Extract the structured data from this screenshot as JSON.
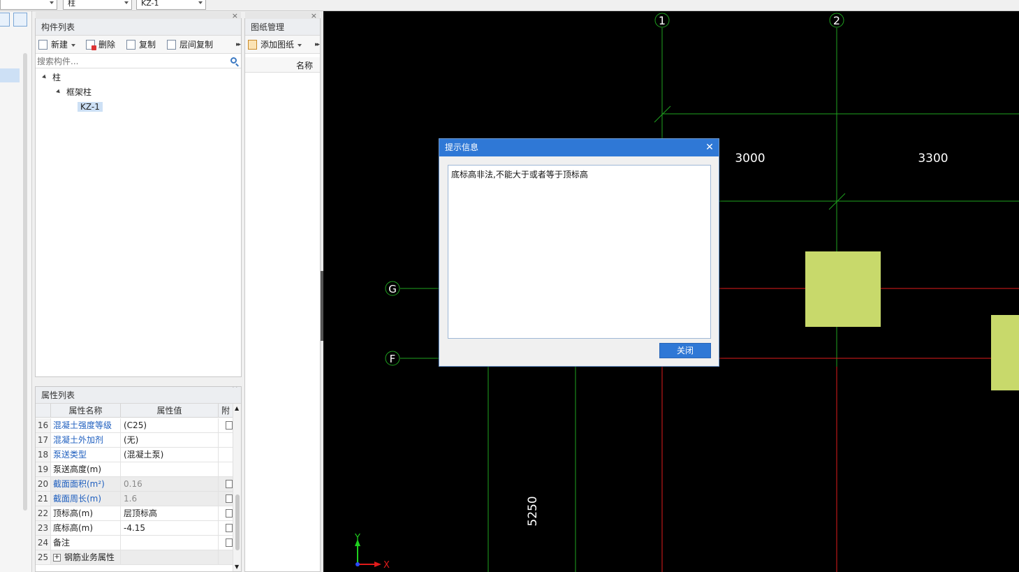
{
  "top_combos": {
    "combo1_value": "",
    "combo2_value": "柱",
    "combo3_value": "KZ-1"
  },
  "component_panel": {
    "title": "构件列表",
    "toolbar": {
      "new_label": "新建",
      "delete_label": "删除",
      "copy_label": "复制",
      "floor_copy_label": "层间复制"
    },
    "search_placeholder": "搜索构件...",
    "tree": {
      "root": "柱",
      "child": "框架柱",
      "leaf": "KZ-1"
    }
  },
  "drawing_panel": {
    "title": "图纸管理",
    "add_label": "添加图纸",
    "column_name": "名称"
  },
  "property_panel": {
    "title": "属性列表",
    "headers": [
      "属性名称",
      "属性值",
      "附"
    ],
    "rows": [
      {
        "num": "16",
        "name": "混凝土强度等级",
        "value": "(C25)",
        "checkbox": true,
        "link": true,
        "readonly": false
      },
      {
        "num": "17",
        "name": "混凝土外加剂",
        "value": "(无)",
        "checkbox": false,
        "link": true,
        "readonly": false
      },
      {
        "num": "18",
        "name": "泵送类型",
        "value": "(混凝土泵)",
        "checkbox": false,
        "link": true,
        "readonly": false
      },
      {
        "num": "19",
        "name": "泵送高度(m)",
        "value": "",
        "checkbox": false,
        "link": false,
        "readonly": false
      },
      {
        "num": "20",
        "name": "截面面积(m²)",
        "value": "0.16",
        "checkbox": true,
        "link": true,
        "readonly": true
      },
      {
        "num": "21",
        "name": "截面周长(m)",
        "value": "1.6",
        "checkbox": true,
        "link": true,
        "readonly": true
      },
      {
        "num": "22",
        "name": "顶标高(m)",
        "value": "层顶标高",
        "checkbox": true,
        "link": false,
        "readonly": false
      },
      {
        "num": "23",
        "name": "底标高(m)",
        "value": "-4.15",
        "checkbox": true,
        "link": false,
        "readonly": false
      },
      {
        "num": "24",
        "name": "备注",
        "value": "",
        "checkbox": true,
        "link": false,
        "readonly": false
      },
      {
        "num": "25",
        "name": "钢筋业务属性",
        "value": "",
        "checkbox": false,
        "link": false,
        "readonly": true,
        "expander": "+"
      }
    ]
  },
  "canvas": {
    "axis_labels": {
      "col1": "1",
      "col2": "2",
      "rowG": "G",
      "rowF": "F"
    },
    "dimensions": {
      "d1": "3000",
      "d2": "3300",
      "d3": "5250"
    },
    "ucs": {
      "x": "X",
      "y": "Y"
    },
    "colors": {
      "background": "#000000",
      "grid": "#1fa31f",
      "axis_red": "#e01b1b",
      "column_fill": "#c8d96b"
    }
  },
  "dialog": {
    "title": "提示信息",
    "message": "底标高非法,不能大于或者等于顶标高",
    "close_button": "关闭"
  }
}
